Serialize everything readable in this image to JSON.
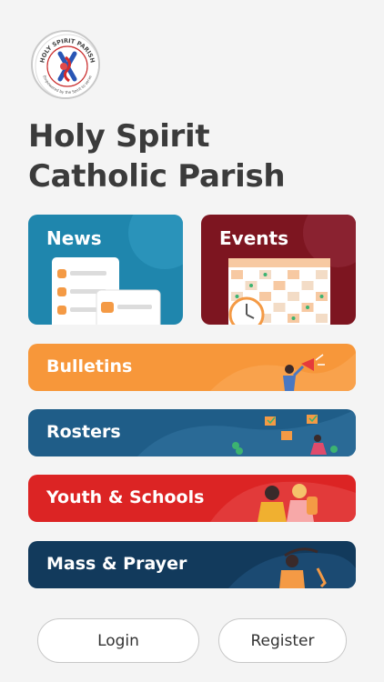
{
  "logo": {
    "top_text": "HOLY SPIRIT PARISH",
    "bottom_text": "Empowered by the Spirit to serve"
  },
  "title": {
    "line1": "Holy Spirit",
    "line2": "Catholic Parish"
  },
  "tiles": [
    {
      "label": "News",
      "color": "#1f86ad"
    },
    {
      "label": "Events",
      "color": "#7d1520"
    }
  ],
  "bars": [
    {
      "label": "Bulletins",
      "color": "#f7973a"
    },
    {
      "label": "Rosters",
      "color": "#1f5d88"
    },
    {
      "label": "Youth & Schools",
      "color": "#dc2424"
    },
    {
      "label": "Mass & Prayer",
      "color": "#123a5c"
    }
  ],
  "buttons": {
    "login": "Login",
    "register": "Register"
  }
}
